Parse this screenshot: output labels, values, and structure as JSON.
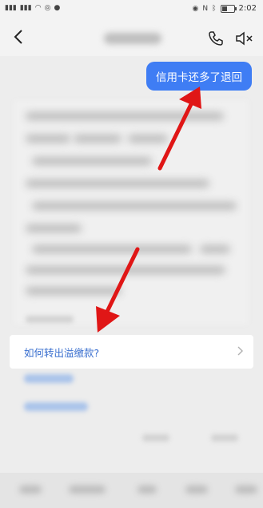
{
  "status_bar": {
    "time": "2:02"
  },
  "chat": {
    "user_message": "信用卡还多了退回"
  },
  "faq": {
    "question": "如何转出溢缴款?"
  },
  "colors": {
    "accent": "#3f7df4",
    "link": "#3a6fcf",
    "arrow": "#e01616"
  }
}
